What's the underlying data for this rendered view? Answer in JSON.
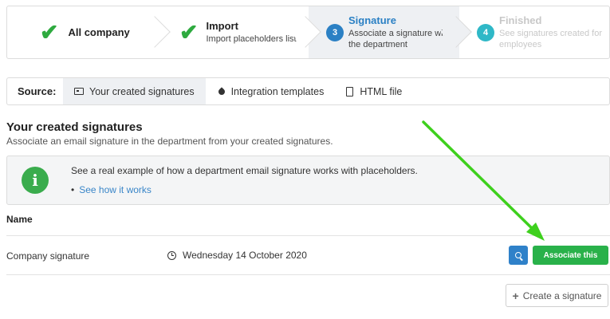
{
  "steps": [
    {
      "title": "All company",
      "subtitle": ""
    },
    {
      "title": "Import",
      "subtitle": "Import placeholders list"
    },
    {
      "number": "3",
      "title": "Signature",
      "subtitle_1": "Associate a signature with",
      "subtitle_2": "the department"
    },
    {
      "number": "4",
      "title": "Finished",
      "subtitle_1": "See signatures created for",
      "subtitle_2": "employees"
    }
  ],
  "source": {
    "label": "Source:",
    "tabs": [
      {
        "label": "Your created signatures",
        "active": true
      },
      {
        "label": "Integration templates",
        "active": false
      },
      {
        "label": "HTML file",
        "active": false
      }
    ]
  },
  "section": {
    "title": "Your created signatures",
    "subtitle": "Associate an email signature in the department from your created signatures."
  },
  "info": {
    "icon": "i",
    "text": "See a real example of how a department email signature works with placeholders.",
    "link": "See how it works"
  },
  "table": {
    "column_name": "Name",
    "rows": [
      {
        "name": "Company signature",
        "date": "Wednesday 14 October 2020",
        "action": "Associate this"
      }
    ]
  },
  "create_button": "Create a signature",
  "colors": {
    "accent_blue": "#2b80c4",
    "success_green": "#29b14a",
    "arrow_green": "#3ed01d",
    "finished_teal": "#2fb8c7"
  }
}
